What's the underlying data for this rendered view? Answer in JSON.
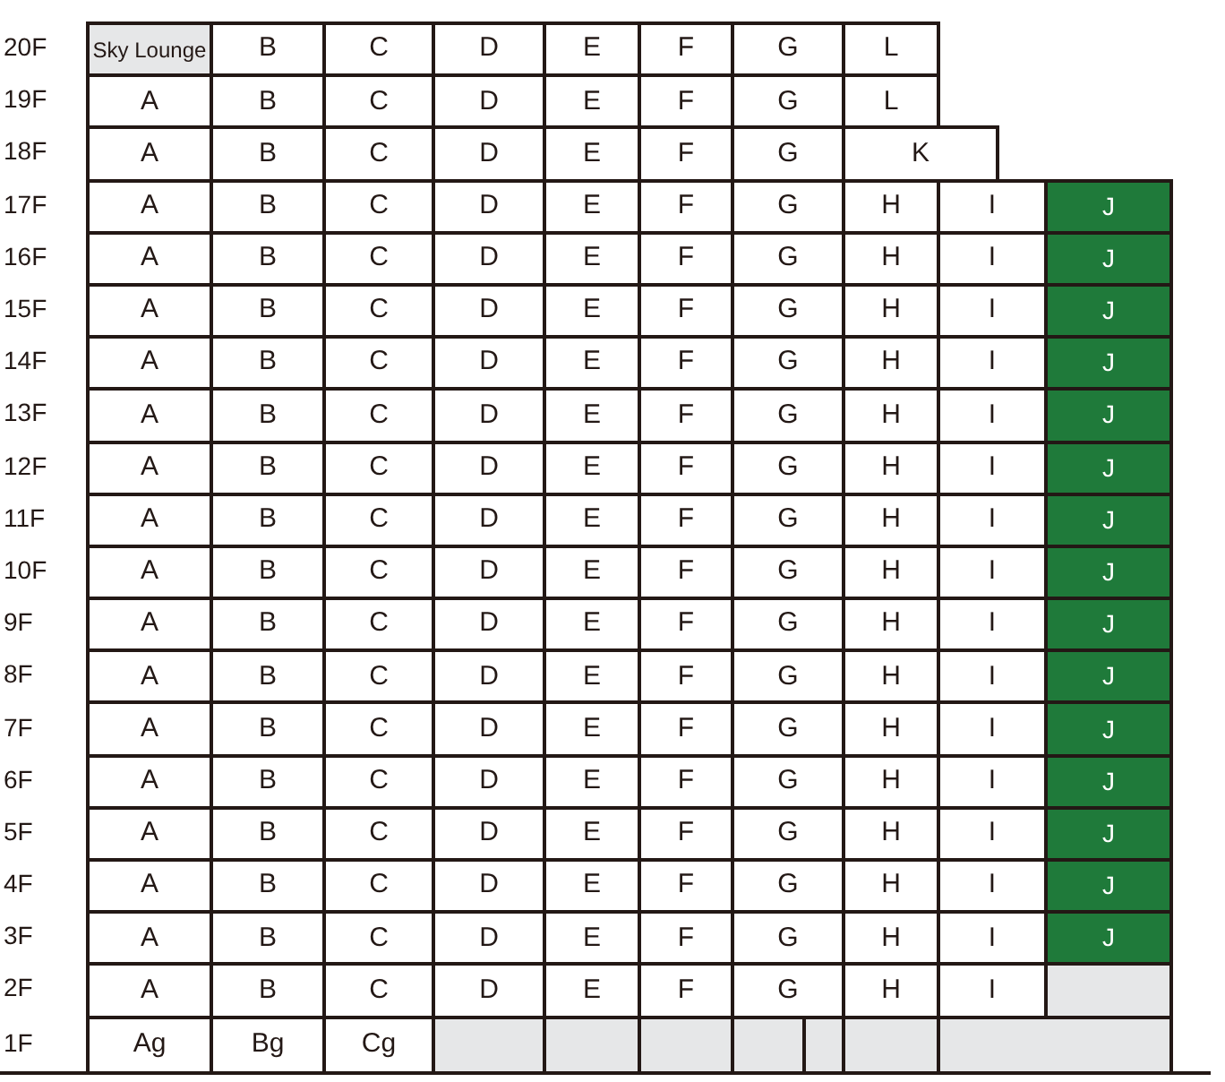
{
  "floors": [
    {
      "label": "20F",
      "kind": "upper",
      "units": [
        {
          "label": "Sky Lounge",
          "kind": "lounge"
        },
        {
          "label": "B",
          "kind": "unit"
        },
        {
          "label": "C",
          "kind": "unit"
        },
        {
          "label": "D",
          "kind": "unit"
        },
        {
          "label": "E",
          "kind": "unit"
        },
        {
          "label": "F",
          "kind": "unit"
        },
        {
          "label": "G",
          "kind": "unit"
        },
        {
          "label": "L",
          "kind": "unit"
        }
      ]
    },
    {
      "label": "19F",
      "kind": "upper",
      "units": [
        {
          "label": "A",
          "kind": "unit"
        },
        {
          "label": "B",
          "kind": "unit"
        },
        {
          "label": "C",
          "kind": "unit"
        },
        {
          "label": "D",
          "kind": "unit"
        },
        {
          "label": "E",
          "kind": "unit"
        },
        {
          "label": "F",
          "kind": "unit"
        },
        {
          "label": "G",
          "kind": "unit"
        },
        {
          "label": "L",
          "kind": "unit"
        }
      ]
    },
    {
      "label": "18F",
      "kind": "upper",
      "units": [
        {
          "label": "A",
          "kind": "unit"
        },
        {
          "label": "B",
          "kind": "unit"
        },
        {
          "label": "C",
          "kind": "unit"
        },
        {
          "label": "D",
          "kind": "unit"
        },
        {
          "label": "E",
          "kind": "unit"
        },
        {
          "label": "F",
          "kind": "unit"
        },
        {
          "label": "G",
          "kind": "unit"
        },
        {
          "label": "K",
          "kind": "wide"
        }
      ]
    },
    {
      "label": "17F",
      "kind": "upper",
      "units": [
        {
          "label": "A",
          "kind": "unit"
        },
        {
          "label": "B",
          "kind": "unit"
        },
        {
          "label": "C",
          "kind": "unit"
        },
        {
          "label": "D",
          "kind": "unit"
        },
        {
          "label": "E",
          "kind": "unit"
        },
        {
          "label": "F",
          "kind": "unit"
        },
        {
          "label": "G",
          "kind": "unit"
        },
        {
          "label": "H",
          "kind": "unit"
        },
        {
          "label": "I",
          "kind": "unit"
        },
        {
          "label": "J",
          "kind": "green"
        }
      ]
    },
    {
      "label": "16F",
      "kind": "upper",
      "units": [
        {
          "label": "A",
          "kind": "unit"
        },
        {
          "label": "B",
          "kind": "unit"
        },
        {
          "label": "C",
          "kind": "unit"
        },
        {
          "label": "D",
          "kind": "unit"
        },
        {
          "label": "E",
          "kind": "unit"
        },
        {
          "label": "F",
          "kind": "unit"
        },
        {
          "label": "G",
          "kind": "unit"
        },
        {
          "label": "H",
          "kind": "unit"
        },
        {
          "label": "I",
          "kind": "unit"
        },
        {
          "label": "J",
          "kind": "green"
        }
      ]
    },
    {
      "label": "15F",
      "kind": "upper",
      "units": [
        {
          "label": "A",
          "kind": "unit"
        },
        {
          "label": "B",
          "kind": "unit"
        },
        {
          "label": "C",
          "kind": "unit"
        },
        {
          "label": "D",
          "kind": "unit"
        },
        {
          "label": "E",
          "kind": "unit"
        },
        {
          "label": "F",
          "kind": "unit"
        },
        {
          "label": "G",
          "kind": "unit"
        },
        {
          "label": "H",
          "kind": "unit"
        },
        {
          "label": "I",
          "kind": "unit"
        },
        {
          "label": "J",
          "kind": "green"
        }
      ]
    },
    {
      "label": "14F",
      "kind": "upper",
      "units": [
        {
          "label": "A",
          "kind": "unit"
        },
        {
          "label": "B",
          "kind": "unit"
        },
        {
          "label": "C",
          "kind": "unit"
        },
        {
          "label": "D",
          "kind": "unit"
        },
        {
          "label": "E",
          "kind": "unit"
        },
        {
          "label": "F",
          "kind": "unit"
        },
        {
          "label": "G",
          "kind": "unit"
        },
        {
          "label": "H",
          "kind": "unit"
        },
        {
          "label": "I",
          "kind": "unit"
        },
        {
          "label": "J",
          "kind": "green"
        }
      ]
    },
    {
      "label": "13F",
      "kind": "upper",
      "units": [
        {
          "label": "A",
          "kind": "unit"
        },
        {
          "label": "B",
          "kind": "unit"
        },
        {
          "label": "C",
          "kind": "unit"
        },
        {
          "label": "D",
          "kind": "unit"
        },
        {
          "label": "E",
          "kind": "unit"
        },
        {
          "label": "F",
          "kind": "unit"
        },
        {
          "label": "G",
          "kind": "unit"
        },
        {
          "label": "H",
          "kind": "unit"
        },
        {
          "label": "I",
          "kind": "unit"
        },
        {
          "label": "J",
          "kind": "green"
        }
      ]
    },
    {
      "label": "12F",
      "kind": "upper",
      "units": [
        {
          "label": "A",
          "kind": "unit"
        },
        {
          "label": "B",
          "kind": "unit"
        },
        {
          "label": "C",
          "kind": "unit"
        },
        {
          "label": "D",
          "kind": "unit"
        },
        {
          "label": "E",
          "kind": "unit"
        },
        {
          "label": "F",
          "kind": "unit"
        },
        {
          "label": "G",
          "kind": "unit"
        },
        {
          "label": "H",
          "kind": "unit"
        },
        {
          "label": "I",
          "kind": "unit"
        },
        {
          "label": "J",
          "kind": "green"
        }
      ]
    },
    {
      "label": "11F",
      "kind": "upper",
      "units": [
        {
          "label": "A",
          "kind": "unit"
        },
        {
          "label": "B",
          "kind": "unit"
        },
        {
          "label": "C",
          "kind": "unit"
        },
        {
          "label": "D",
          "kind": "unit"
        },
        {
          "label": "E",
          "kind": "unit"
        },
        {
          "label": "F",
          "kind": "unit"
        },
        {
          "label": "G",
          "kind": "unit"
        },
        {
          "label": "H",
          "kind": "unit"
        },
        {
          "label": "I",
          "kind": "unit"
        },
        {
          "label": "J",
          "kind": "green"
        }
      ]
    },
    {
      "label": "10F",
      "kind": "upper",
      "units": [
        {
          "label": "A",
          "kind": "unit"
        },
        {
          "label": "B",
          "kind": "unit"
        },
        {
          "label": "C",
          "kind": "unit"
        },
        {
          "label": "D",
          "kind": "unit"
        },
        {
          "label": "E",
          "kind": "unit"
        },
        {
          "label": "F",
          "kind": "unit"
        },
        {
          "label": "G",
          "kind": "unit"
        },
        {
          "label": "H",
          "kind": "unit"
        },
        {
          "label": "I",
          "kind": "unit"
        },
        {
          "label": "J",
          "kind": "green"
        }
      ]
    },
    {
      "label": "9F",
      "kind": "upper",
      "units": [
        {
          "label": "A",
          "kind": "unit"
        },
        {
          "label": "B",
          "kind": "unit"
        },
        {
          "label": "C",
          "kind": "unit"
        },
        {
          "label": "D",
          "kind": "unit"
        },
        {
          "label": "E",
          "kind": "unit"
        },
        {
          "label": "F",
          "kind": "unit"
        },
        {
          "label": "G",
          "kind": "unit"
        },
        {
          "label": "H",
          "kind": "unit"
        },
        {
          "label": "I",
          "kind": "unit"
        },
        {
          "label": "J",
          "kind": "green"
        }
      ]
    },
    {
      "label": "8F",
      "kind": "upper",
      "units": [
        {
          "label": "A",
          "kind": "unit"
        },
        {
          "label": "B",
          "kind": "unit"
        },
        {
          "label": "C",
          "kind": "unit"
        },
        {
          "label": "D",
          "kind": "unit"
        },
        {
          "label": "E",
          "kind": "unit"
        },
        {
          "label": "F",
          "kind": "unit"
        },
        {
          "label": "G",
          "kind": "unit"
        },
        {
          "label": "H",
          "kind": "unit"
        },
        {
          "label": "I",
          "kind": "unit"
        },
        {
          "label": "J",
          "kind": "green"
        }
      ]
    },
    {
      "label": "7F",
      "kind": "upper",
      "units": [
        {
          "label": "A",
          "kind": "unit"
        },
        {
          "label": "B",
          "kind": "unit"
        },
        {
          "label": "C",
          "kind": "unit"
        },
        {
          "label": "D",
          "kind": "unit"
        },
        {
          "label": "E",
          "kind": "unit"
        },
        {
          "label": "F",
          "kind": "unit"
        },
        {
          "label": "G",
          "kind": "unit"
        },
        {
          "label": "H",
          "kind": "unit"
        },
        {
          "label": "I",
          "kind": "unit"
        },
        {
          "label": "J",
          "kind": "green"
        }
      ]
    },
    {
      "label": "6F",
      "kind": "upper",
      "units": [
        {
          "label": "A",
          "kind": "unit"
        },
        {
          "label": "B",
          "kind": "unit"
        },
        {
          "label": "C",
          "kind": "unit"
        },
        {
          "label": "D",
          "kind": "unit"
        },
        {
          "label": "E",
          "kind": "unit"
        },
        {
          "label": "F",
          "kind": "unit"
        },
        {
          "label": "G",
          "kind": "unit"
        },
        {
          "label": "H",
          "kind": "unit"
        },
        {
          "label": "I",
          "kind": "unit"
        },
        {
          "label": "J",
          "kind": "green"
        }
      ]
    },
    {
      "label": "5F",
      "kind": "upper",
      "units": [
        {
          "label": "A",
          "kind": "unit"
        },
        {
          "label": "B",
          "kind": "unit"
        },
        {
          "label": "C",
          "kind": "unit"
        },
        {
          "label": "D",
          "kind": "unit"
        },
        {
          "label": "E",
          "kind": "unit"
        },
        {
          "label": "F",
          "kind": "unit"
        },
        {
          "label": "G",
          "kind": "unit"
        },
        {
          "label": "H",
          "kind": "unit"
        },
        {
          "label": "I",
          "kind": "unit"
        },
        {
          "label": "J",
          "kind": "green"
        }
      ]
    },
    {
      "label": "4F",
      "kind": "upper",
      "units": [
        {
          "label": "A",
          "kind": "unit"
        },
        {
          "label": "B",
          "kind": "unit"
        },
        {
          "label": "C",
          "kind": "unit"
        },
        {
          "label": "D",
          "kind": "unit"
        },
        {
          "label": "E",
          "kind": "unit"
        },
        {
          "label": "F",
          "kind": "unit"
        },
        {
          "label": "G",
          "kind": "unit"
        },
        {
          "label": "H",
          "kind": "unit"
        },
        {
          "label": "I",
          "kind": "unit"
        },
        {
          "label": "J",
          "kind": "green"
        }
      ]
    },
    {
      "label": "3F",
      "kind": "upper",
      "units": [
        {
          "label": "A",
          "kind": "unit"
        },
        {
          "label": "B",
          "kind": "unit"
        },
        {
          "label": "C",
          "kind": "unit"
        },
        {
          "label": "D",
          "kind": "unit"
        },
        {
          "label": "E",
          "kind": "unit"
        },
        {
          "label": "F",
          "kind": "unit"
        },
        {
          "label": "G",
          "kind": "unit"
        },
        {
          "label": "H",
          "kind": "unit"
        },
        {
          "label": "I",
          "kind": "unit"
        },
        {
          "label": "J",
          "kind": "green"
        }
      ]
    },
    {
      "label": "2F",
      "kind": "upper",
      "units": [
        {
          "label": "A",
          "kind": "unit"
        },
        {
          "label": "B",
          "kind": "unit"
        },
        {
          "label": "C",
          "kind": "unit"
        },
        {
          "label": "D",
          "kind": "unit"
        },
        {
          "label": "E",
          "kind": "unit"
        },
        {
          "label": "F",
          "kind": "unit"
        },
        {
          "label": "G",
          "kind": "unit"
        },
        {
          "label": "H",
          "kind": "unit"
        },
        {
          "label": "I",
          "kind": "unit"
        },
        {
          "kind": "vacant"
        }
      ]
    },
    {
      "label": "1F",
      "kind": "ground",
      "units": [
        {
          "label": "Ag",
          "kind": "unit"
        },
        {
          "label": "Bg",
          "kind": "unit"
        },
        {
          "label": "Cg",
          "kind": "unit"
        },
        {
          "kind": "vacant"
        },
        {
          "kind": "vacant"
        },
        {
          "kind": "vacant"
        },
        {
          "kind": "vacant"
        },
        {
          "kind": "vacant"
        },
        {
          "kind": "vacant"
        },
        {
          "kind": "vacant"
        }
      ]
    }
  ]
}
